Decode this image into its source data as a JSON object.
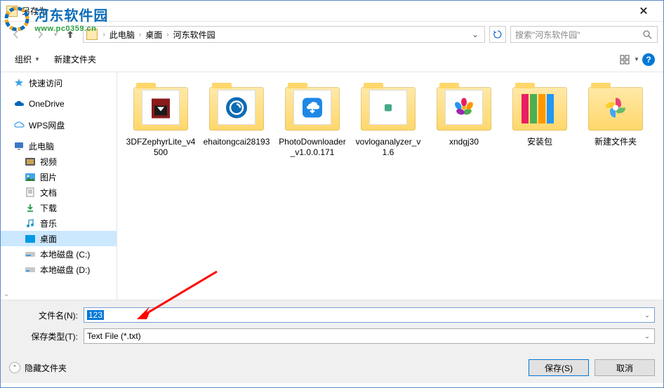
{
  "window": {
    "title": "另存为"
  },
  "watermark": {
    "main": "河东软件园",
    "sub": "www.pc0359.cn"
  },
  "breadcrumb": {
    "items": [
      "此电脑",
      "桌面",
      "河东软件园"
    ]
  },
  "search": {
    "placeholder": "搜索\"河东软件园\""
  },
  "toolbar": {
    "organize": "组织",
    "newfolder": "新建文件夹"
  },
  "sidebar": {
    "quick": "快速访问",
    "onedrive": "OneDrive",
    "wps": "WPS网盘",
    "thispc": "此电脑",
    "video": "视频",
    "pictures": "图片",
    "documents": "文档",
    "downloads": "下载",
    "music": "音乐",
    "desktop": "桌面",
    "diskc": "本地磁盘 (C:)",
    "diskd": "本地磁盘 (D:)"
  },
  "files": [
    {
      "name": "3DFZephyrLite_v4500",
      "thumb": "box"
    },
    {
      "name": "ehaitongcai28193",
      "thumb": "blue-circle"
    },
    {
      "name": "PhotoDownloader_v1.0.0.171",
      "thumb": "blue-cloud"
    },
    {
      "name": "vovloganalyzer_v1.6",
      "thumb": "small-icon"
    },
    {
      "name": "xndgj30",
      "thumb": "pinwheel"
    },
    {
      "name": "安装包",
      "thumb": "colorbars"
    },
    {
      "name": "新建文件夹",
      "thumb": "pinwheel2"
    }
  ],
  "fields": {
    "filename_label": "文件名(N):",
    "filename_value": "123",
    "filetype_label": "保存类型(T):",
    "filetype_value": "Text File (*.txt)"
  },
  "footer": {
    "hide_folders": "隐藏文件夹",
    "save": "保存(S)",
    "cancel": "取消"
  }
}
